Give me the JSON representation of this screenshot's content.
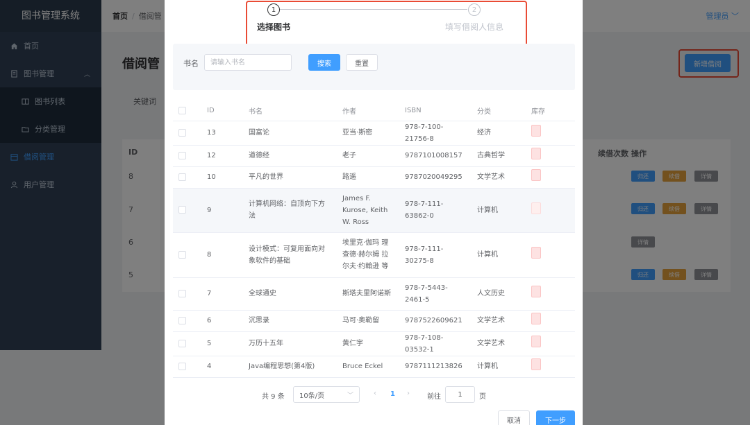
{
  "app": {
    "brand": "图书管理系统",
    "user": "管理员"
  },
  "sidebar": {
    "items": [
      {
        "label": "首页",
        "icon": "home-icon"
      },
      {
        "label": "图书管理",
        "icon": "document-icon"
      },
      {
        "label": "图书列表",
        "icon": "book-icon"
      },
      {
        "label": "分类管理",
        "icon": "folder-icon"
      },
      {
        "label": "借阅管理",
        "icon": "calendar-icon"
      },
      {
        "label": "用户管理",
        "icon": "user-icon"
      }
    ]
  },
  "breadcrumb": {
    "home": "首页",
    "current": "借阅管"
  },
  "page": {
    "title": "借阅管",
    "add_button": "新增借阅",
    "keyword_label": "关键词",
    "table_headers": {
      "id": "ID",
      "renew_count": "续借次数",
      "actions": "操作"
    },
    "rows": [
      {
        "id": "8",
        "actions": [
          "归还",
          "续借",
          "详情"
        ]
      },
      {
        "id": "7",
        "actions": [
          "归还",
          "续借",
          "详情"
        ]
      },
      {
        "id": "6",
        "actions": [
          "详情"
        ]
      },
      {
        "id": "5",
        "actions": [
          "归还",
          "续借",
          "详情"
        ]
      }
    ]
  },
  "dialog": {
    "steps": [
      {
        "number": "1",
        "title": "选择图书",
        "status": "active"
      },
      {
        "number": "2",
        "title": "填写借阅人信息",
        "status": "wait"
      }
    ],
    "search": {
      "label": "书名",
      "placeholder": "请输入书名",
      "search_button": "搜索",
      "reset_button": "重置"
    },
    "table": {
      "headers": [
        "ID",
        "书名",
        "作者",
        "ISBN",
        "分类",
        "库存"
      ],
      "rows": [
        {
          "id": "13",
          "title": "国富论",
          "author": "亚当·斯密",
          "isbn": "978-7-100-21756-8",
          "category": "经济"
        },
        {
          "id": "12",
          "title": "道德经",
          "author": "老子",
          "isbn": "9787101008157",
          "category": "古典哲学"
        },
        {
          "id": "10",
          "title": "平凡的世界",
          "author": "路遥",
          "isbn": "9787020049295",
          "category": "文学艺术"
        },
        {
          "id": "9",
          "title": "计算机网络：自顶向下方法",
          "author": "James F. Kurose, Keith W. Ross",
          "isbn": "978-7-111-63862-0",
          "category": "计算机"
        },
        {
          "id": "8",
          "title": "设计模式：可复用面向对象软件的基础",
          "author": "埃里克·伽玛 理查德·赫尔姆 拉尔夫·约翰逊 等",
          "isbn": "978-7-111-30275-8",
          "category": "计算机"
        },
        {
          "id": "7",
          "title": "全球通史",
          "author": "斯塔夫里阿诺斯",
          "isbn": "978-7-5443-2461-5",
          "category": "人文历史"
        },
        {
          "id": "6",
          "title": "沉思录",
          "author": "马可·奥勒留",
          "isbn": "9787522609621",
          "category": "文学艺术"
        },
        {
          "id": "5",
          "title": "万历十五年",
          "author": "黄仁宇",
          "isbn": "978-7-108-03532-1",
          "category": "文学艺术"
        },
        {
          "id": "4",
          "title": "Java编程思想(第4版)",
          "author": "Bruce Eckel",
          "isbn": "9787111213826",
          "category": "计算机"
        }
      ]
    },
    "pagination": {
      "total": "共 9 条",
      "page_size": "10条/页",
      "current_page": "1",
      "goto_label": "前往",
      "goto_value": "1",
      "page_suffix": "页"
    },
    "footer": {
      "cancel": "取消",
      "next": "下一步"
    }
  },
  "colors": {
    "primary": "#409eff",
    "sidebar_bg": "#304156",
    "highlight": "#e94b35"
  }
}
